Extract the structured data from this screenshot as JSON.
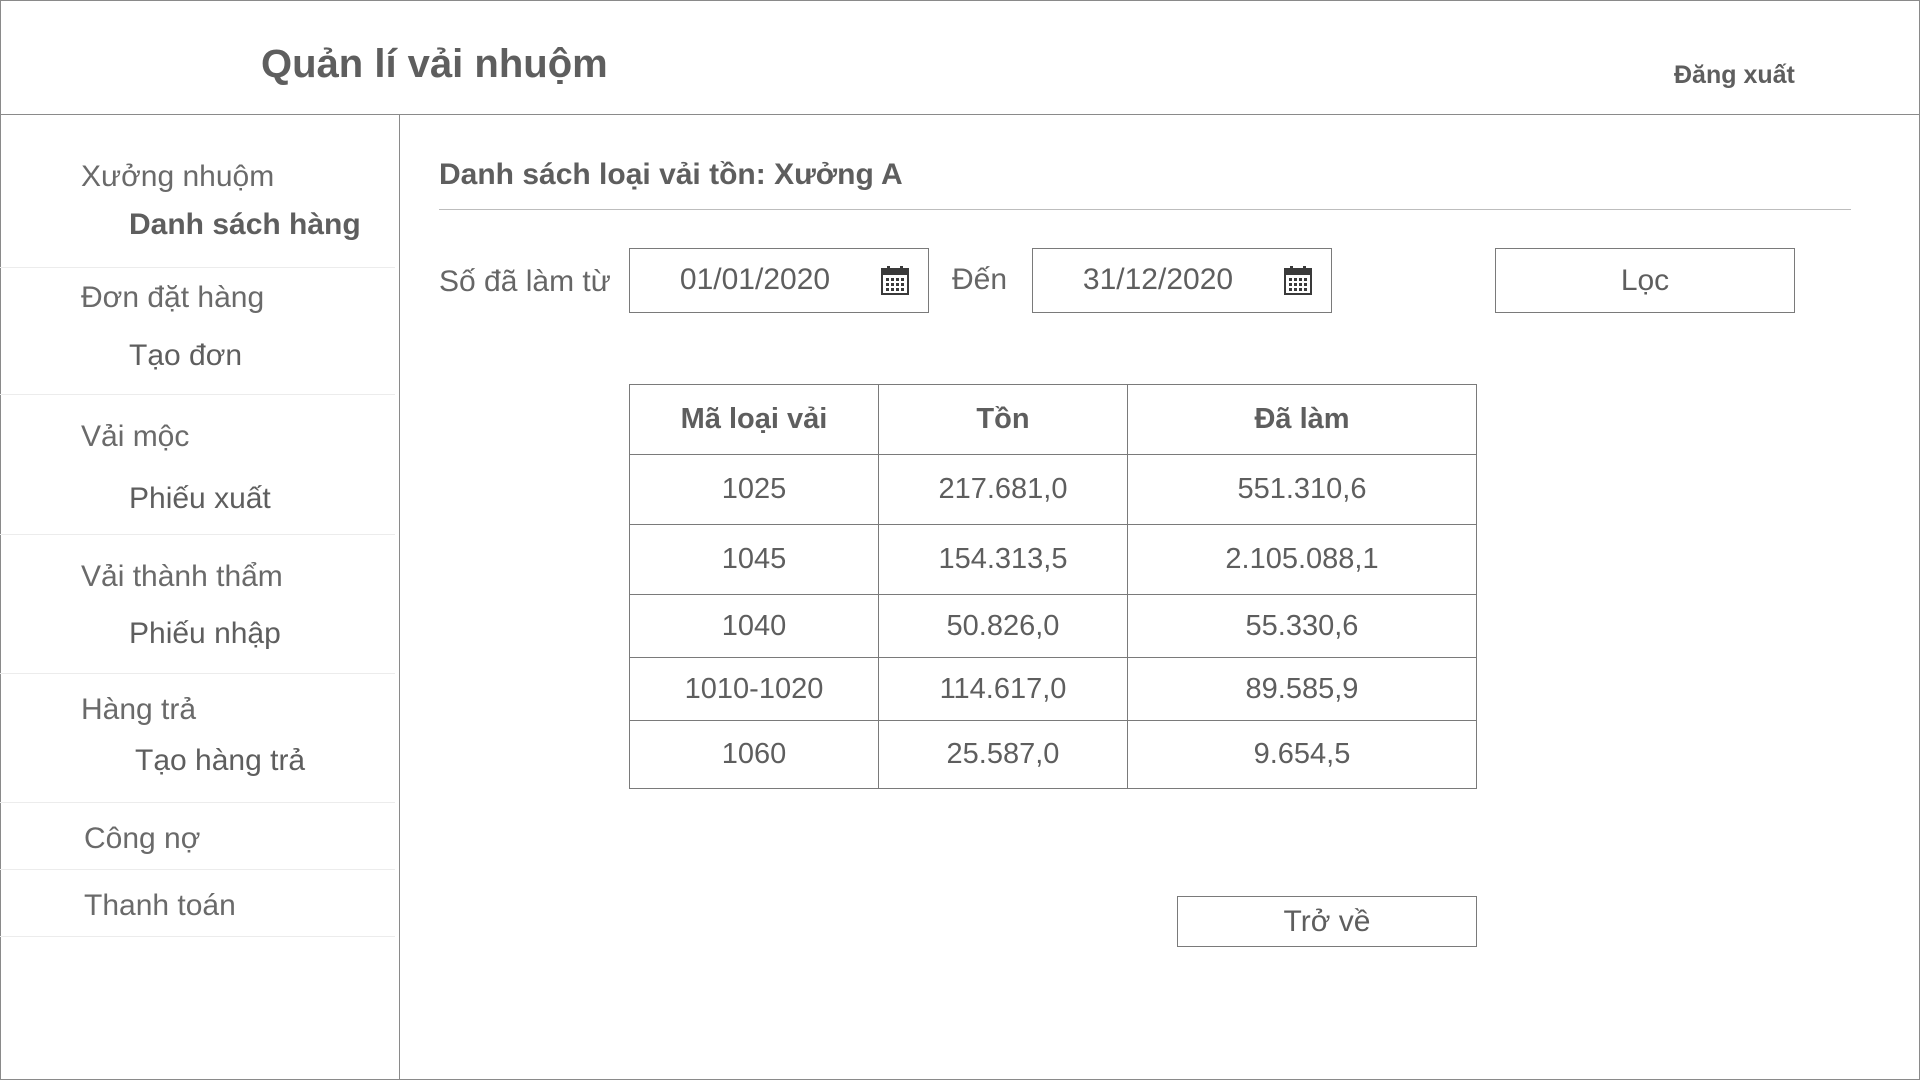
{
  "header": {
    "title": "Quản lí vải nhuộm",
    "logout_label": "Đăng xuất"
  },
  "sidebar": {
    "groups": [
      {
        "label": "Xưởng nhuộm",
        "sub": "Danh sách hàng"
      },
      {
        "label": "Đơn đặt hàng",
        "sub": "Tạo đơn"
      },
      {
        "label": "Vải mộc",
        "sub": "Phiếu xuất"
      },
      {
        "label": "Vải thành thẩm",
        "sub": "Phiếu nhập"
      },
      {
        "label": "Hàng trả",
        "sub": "Tạo hàng trả"
      },
      {
        "label": "Công nợ"
      },
      {
        "label": "Thanh toán"
      }
    ]
  },
  "main": {
    "title": "Danh sách loại vải tồn: Xưởng A",
    "filter": {
      "from_label": "Số đã làm từ",
      "from_value": "01/01/2020",
      "to_label": "Đến",
      "to_value": "31/12/2020",
      "filter_button": "Lọc"
    },
    "table": {
      "headers": [
        "Mã loại vải",
        "Tồn",
        "Đã làm"
      ],
      "rows": [
        [
          "1025",
          "217.681,0",
          "551.310,6"
        ],
        [
          "1045",
          "154.313,5",
          "2.105.088,1"
        ],
        [
          "1040",
          "50.826,0",
          "55.330,6"
        ],
        [
          "1010-1020",
          "114.617,0",
          "89.585,9"
        ],
        [
          "1060",
          "25.587,0",
          "9.654,5"
        ]
      ]
    },
    "back_button": "Trở về"
  },
  "icons": {
    "date_picker": "calendar-icon"
  }
}
